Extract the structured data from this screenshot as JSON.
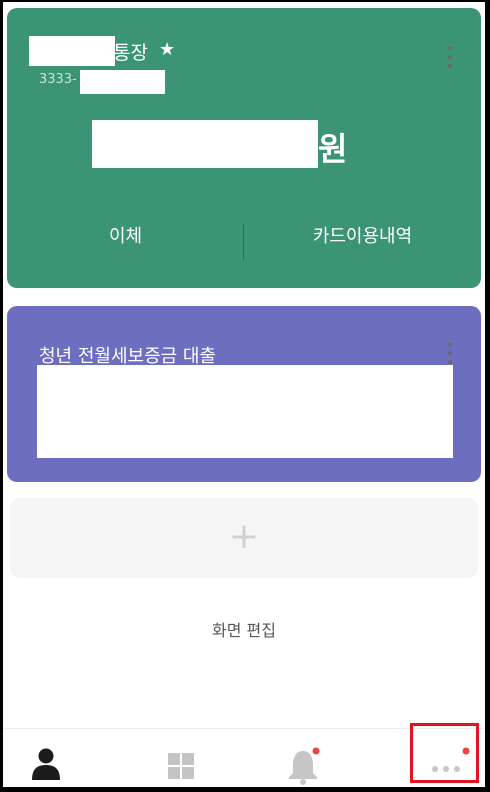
{
  "account": {
    "name": "통장",
    "number_prefix": "3333-",
    "currency_unit": "원",
    "actions": {
      "transfer": "이체",
      "card_history": "카드이용내역"
    }
  },
  "loan": {
    "title": "청년 전월세보증금 대출"
  },
  "add_card": {
    "icon": "plus-icon",
    "symbol": "+"
  },
  "edit_screen": "화면 편집",
  "tabbar": {
    "tabs": [
      {
        "name": "profile",
        "icon": "person-icon"
      },
      {
        "name": "menu",
        "icon": "grid-icon"
      },
      {
        "name": "notifications",
        "icon": "bell-icon",
        "badge": true
      },
      {
        "name": "more",
        "icon": "more-dots-icon",
        "badge": true
      }
    ]
  },
  "colors": {
    "account_card": "#3b9474",
    "loan_card": "#6e6ec0",
    "badge": "#ee4444",
    "highlight": "#e0161e"
  }
}
